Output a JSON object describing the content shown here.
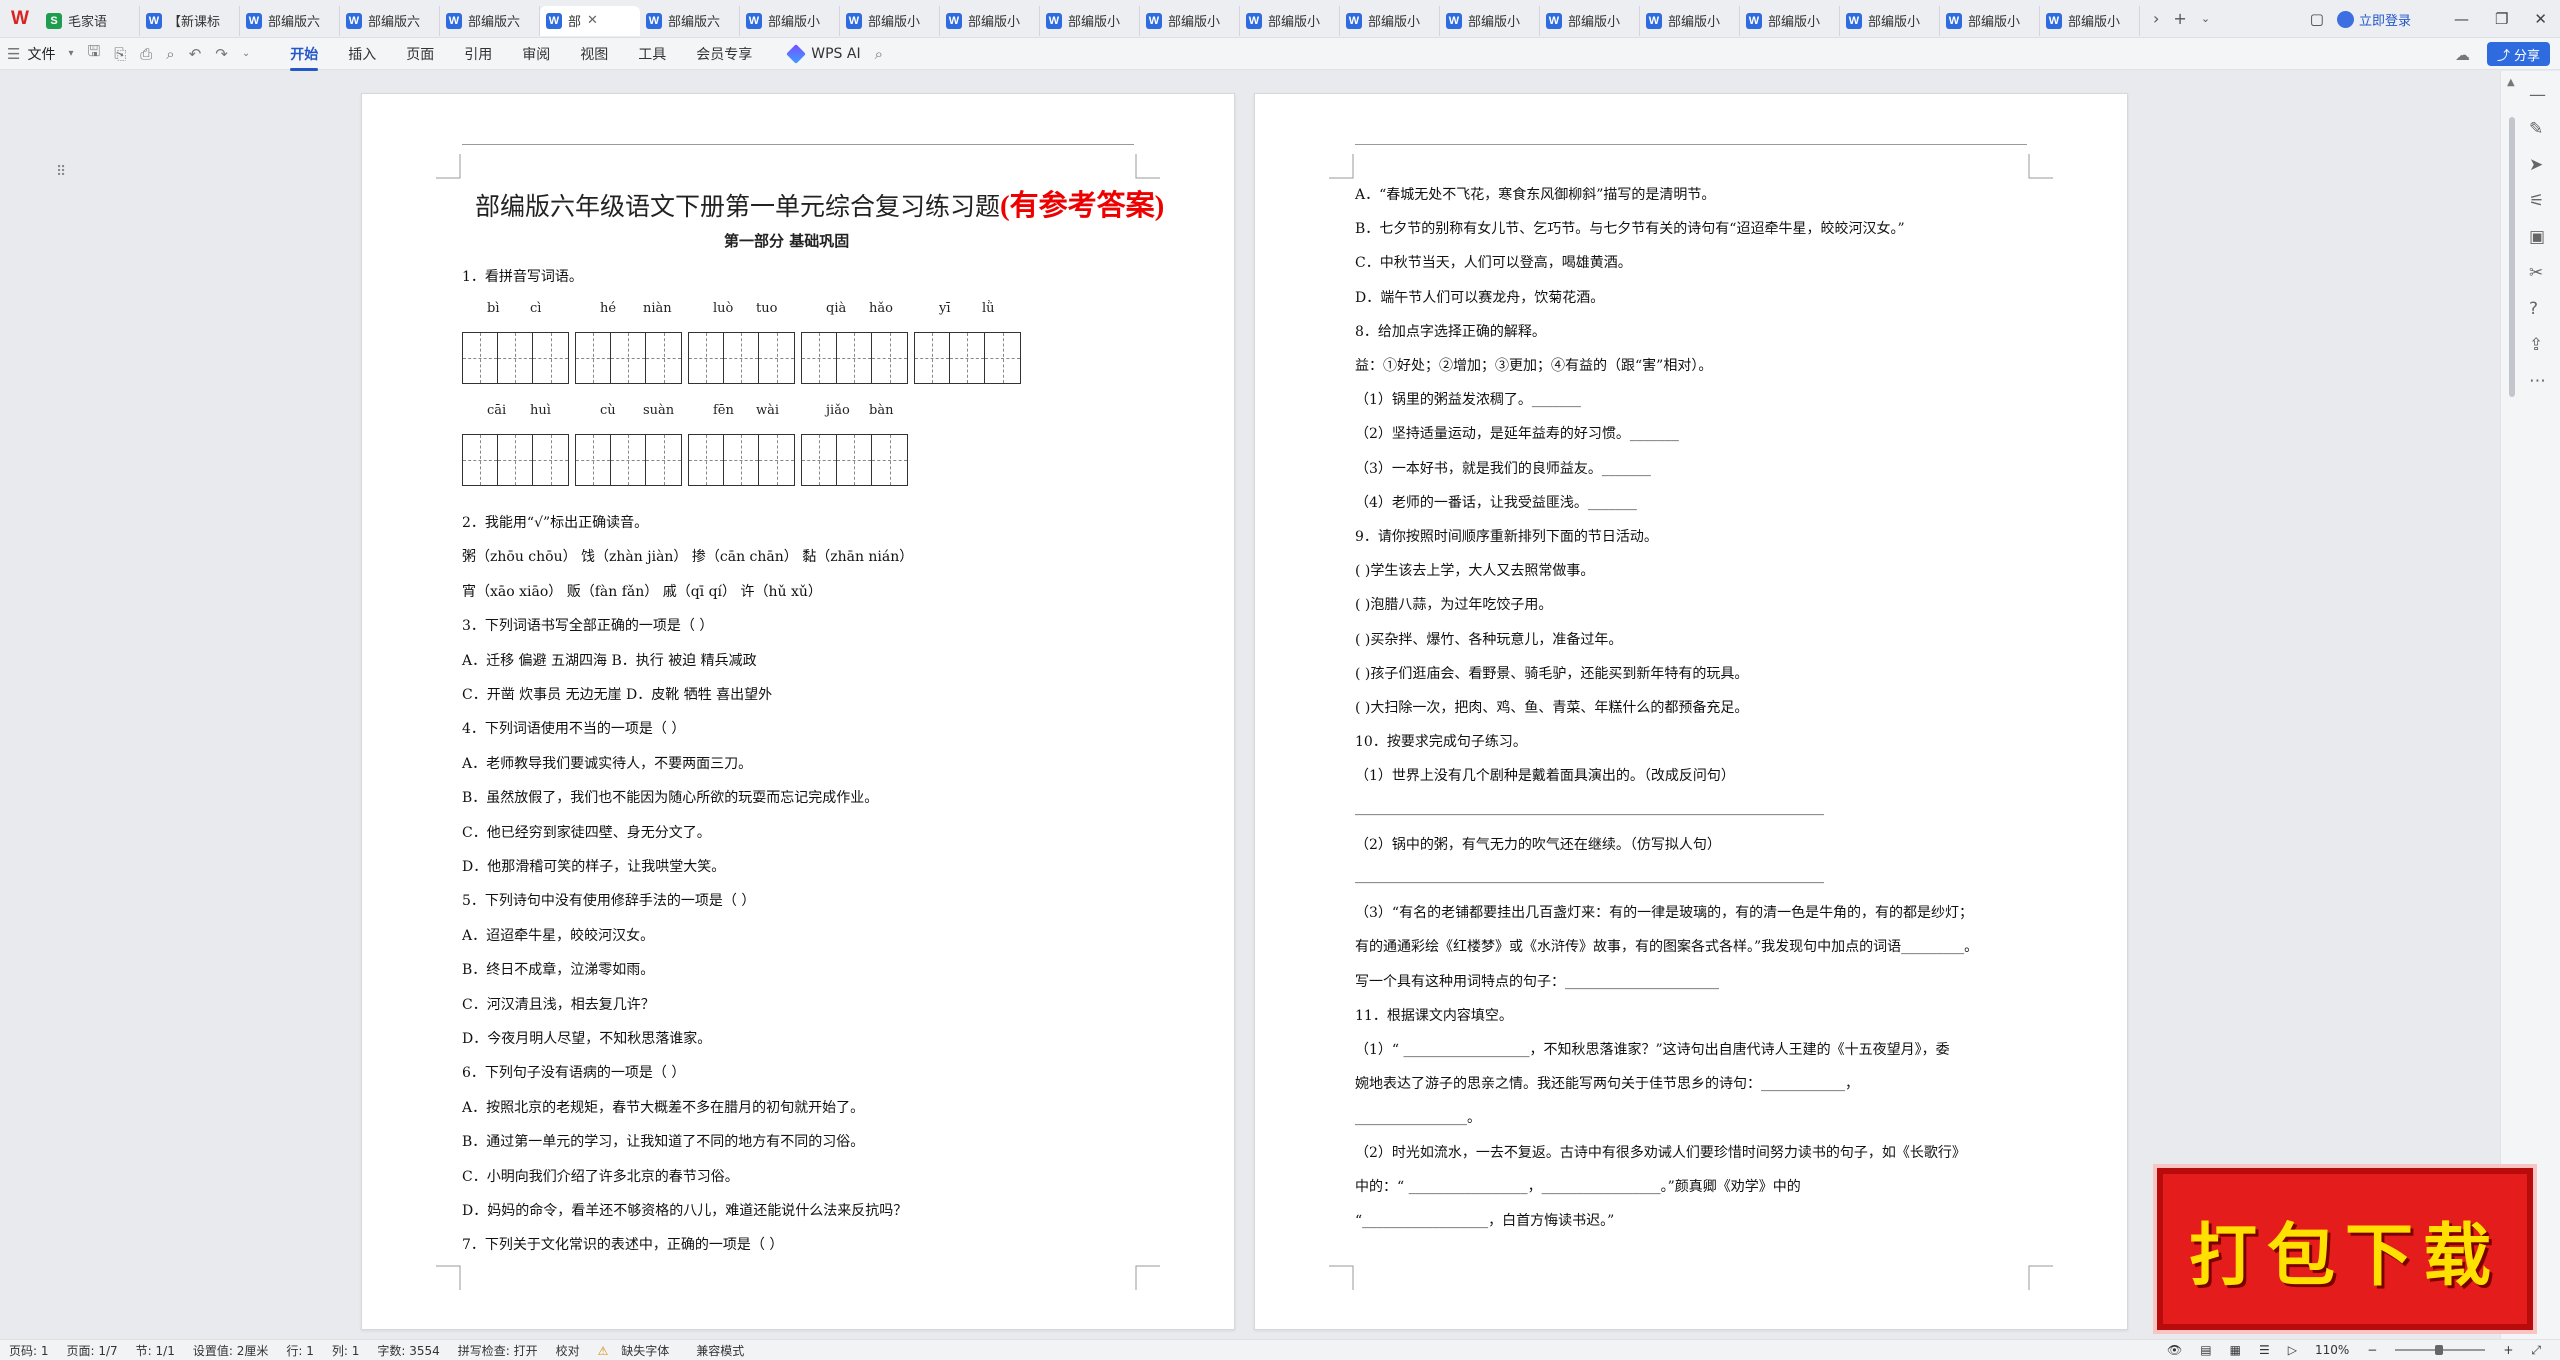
{
  "tabs": [
    {
      "label": "毛家语",
      "icon": "S",
      "kind": "s"
    },
    {
      "label": "【新课标",
      "icon": "W",
      "kind": "w"
    },
    {
      "label": "部编版六",
      "icon": "W",
      "kind": "w"
    },
    {
      "label": "部编版六",
      "icon": "W",
      "kind": "w"
    },
    {
      "label": "部编版六",
      "icon": "W",
      "kind": "w"
    },
    {
      "label": "部",
      "icon": "W",
      "kind": "w",
      "active": true
    },
    {
      "label": "部编版六",
      "icon": "W",
      "kind": "w"
    },
    {
      "label": "部编版小",
      "icon": "W",
      "kind": "w"
    },
    {
      "label": "部编版小",
      "icon": "W",
      "kind": "w"
    },
    {
      "label": "部编版小",
      "icon": "W",
      "kind": "w"
    },
    {
      "label": "部编版小",
      "icon": "W",
      "kind": "w"
    },
    {
      "label": "部编版小",
      "icon": "W",
      "kind": "w"
    },
    {
      "label": "部编版小",
      "icon": "W",
      "kind": "w"
    },
    {
      "label": "部编版小",
      "icon": "W",
      "kind": "w"
    },
    {
      "label": "部编版小",
      "icon": "W",
      "kind": "w"
    },
    {
      "label": "部编版小",
      "icon": "W",
      "kind": "w"
    },
    {
      "label": "部编版小",
      "icon": "W",
      "kind": "w"
    },
    {
      "label": "部编版小",
      "icon": "W",
      "kind": "w"
    },
    {
      "label": "部编版小",
      "icon": "W",
      "kind": "w"
    },
    {
      "label": "部编版小",
      "icon": "W",
      "kind": "w"
    },
    {
      "label": "部编版小",
      "icon": "W",
      "kind": "w"
    }
  ],
  "login": "立即登录",
  "menu": {
    "file": "文件",
    "items": [
      "开始",
      "插入",
      "页面",
      "引用",
      "审阅",
      "视图",
      "工具",
      "会员专享"
    ],
    "ai": "WPS AI",
    "share": "分享"
  },
  "page1": {
    "title": "部编版六年级语文下册第一单元综合复习练习题",
    "title_red": "(有参考答案)",
    "section": "第一部分    基础巩固",
    "q1": "1．看拼音写词语。",
    "pinyin_row1": [
      [
        "bì",
        "cì"
      ],
      [
        "hé",
        "niàn"
      ],
      [
        "luò",
        "tuo"
      ],
      [
        "qià",
        "hǎo"
      ],
      [
        "yī",
        "lǜ"
      ]
    ],
    "pinyin_row2": [
      [
        "cāi",
        "huì"
      ],
      [
        "cù",
        "suàn"
      ],
      [
        "fēn",
        "wài"
      ],
      [
        "jiǎo",
        "bàn"
      ]
    ],
    "lines": [
      "2．我能用“√”标出正确读音。",
      "粥（zhōu chōu）    饯（zhàn jiàn）    掺（cān chān）    黏（zhān nián）",
      "宵（xāo xiāo）      贩（fàn fǎn）      戚（qī qí）          许（hǔ xǔ）",
      "3．下列词语书写全部正确的一项是（    ）",
      "A．迁移   偏避   五湖四海                                       B．执行   被迫   精兵减政",
      "C．开凿   炊事员   无边无崖                                     D．皮靴   牺牲   喜出望外",
      "4．下列词语使用不当的一项是（    ）",
      "A．老师教导我们要诚实待人，不要两面三刀。",
      "B．虽然放假了，我们也不能因为随心所欲的玩耍而忘记完成作业。",
      "C．他已经穷到家徒四壁、身无分文了。",
      "D．他那滑稽可笑的样子，让我哄堂大笑。",
      "5．下列诗句中没有使用修辞手法的一项是（        ）",
      "A．迢迢牵牛星，皎皎河汉女。",
      "B．终日不成章，泣涕零如雨。",
      "C．河汉清且浅，相去复几许？",
      "D．今夜月明人尽望，不知秋思落谁家。",
      "6．下列句子没有语病的一项是（    ）",
      "A．按照北京的老规矩，春节大概差不多在腊月的初旬就开始了。",
      "B．通过第一单元的学习，让我知道了不同的地方有不同的习俗。",
      "C．小明向我们介绍了许多北京的春节习俗。",
      "D．妈妈的命令，看羊还不够资格的八儿，难道还能说什么法来反抗吗？",
      "7．下列关于文化常识的表述中，正确的一项是（    ）"
    ]
  },
  "page2": {
    "lines": [
      "A．“春城无处不飞花，寒食东风御柳斜”描写的是清明节。",
      "B．七夕节的别称有女儿节、乞巧节。与七夕节有关的诗句有“迢迢牵牛星，皎皎河汉女。”",
      "C．中秋节当天，人们可以登高，喝雄黄酒。",
      "D．端午节人们可以赛龙舟，饮菊花酒。",
      "8．给加点字选择正确的解释。",
      "益：①好处；②增加；③更加；④有益的（跟“害”相对）。",
      "（1）锅里的粥益发浓稠了。_______",
      "（2）坚持适量运动，是延年益寿的好习惯。_______",
      "（3）一本好书，就是我们的良师益友。_______",
      "（4）老师的一番话，让我受益匪浅。_______",
      "9．请你按照时间顺序重新排列下面的节日活动。",
      "(        )学生该去上学，大人又去照常做事。",
      "(        )泡腊八蒜，为过年吃饺子用。",
      "(        )买杂拌、爆竹、各种玩意儿，准备过年。",
      "(        )孩子们逛庙会、看野景、骑毛驴，还能买到新年特有的玩具。",
      "(        )大扫除一次，把肉、鸡、鱼、青菜、年糕什么的都预备充足。",
      "10．按要求完成句子练习。",
      "（1）世界上没有几个剧种是戴着面具演出的。（改成反问句）",
      "___________________________________________________________________",
      "（2）锅中的粥，有气无力的吹气还在继续。（仿写拟人句）",
      "___________________________________________________________________",
      "（3）“有名的老铺都要挂出几百盏灯来：有的一律是玻璃的，有的清一色是牛角的，有的都是纱灯；",
      "有的通通彩绘《红楼梦》或《水浒传》故事，有的图案各式各样。”我发现句中加点的词语_________。",
      "写一个具有这种用词特点的句子：______________________",
      "11．根据课文内容填空。",
      "（1）“ __________________，不知秋思落谁家？”这诗句出自唐代诗人王建的《十五夜望月》，委",
      "婉地表达了游子的思亲之情。我还能写两句关于佳节思乡的诗句：____________，",
      "________________。",
      "（2）时光如流水，一去不复返。古诗中有很多劝诫人们要珍惜时间努力读书的句子，如《长歌行》",
      "中的：“ _________________，_________________。”颜真卿《劝学》中的",
      "“__________________，白首方悔读书迟。”"
    ]
  },
  "status": {
    "page": "页码: 1",
    "pages": "页面: 1/7",
    "section": "节: 1/1",
    "setting": "设置值: 2厘米",
    "row": "行: 1",
    "col": "列: 1",
    "words": "字数: 3554",
    "spell": "拼写检查: 打开",
    "proof": "校对",
    "font": "缺失字体",
    "compat": "兼容模式",
    "zoom": "110%"
  },
  "banner": "打包下载"
}
